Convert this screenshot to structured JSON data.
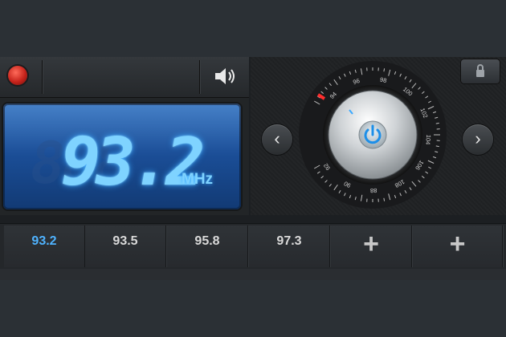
{
  "window": {
    "background": "#2b3035"
  },
  "topbar": {
    "record_icon": "record-icon",
    "speaker_icon": "speaker-icon"
  },
  "display": {
    "frequency": "93.2",
    "ghost_digits": "888",
    "unit": "MHz",
    "accent_color": "#7fd3ff"
  },
  "tuner": {
    "lock_icon": "lock-icon",
    "prev_icon": "chevron-left-icon",
    "next_icon": "chevron-right-icon",
    "power_icon": "power-icon",
    "scale_labels": [
      "94",
      "96",
      "98",
      "100",
      "102",
      "104",
      "106",
      "108",
      "88",
      "90",
      "92"
    ],
    "needle_color": "#ff2d2d"
  },
  "presets": [
    {
      "label": "93.2",
      "active": true
    },
    {
      "label": "93.5",
      "active": false
    },
    {
      "label": "95.8",
      "active": false
    },
    {
      "label": "97.3",
      "active": false
    },
    {
      "label": "+",
      "active": false
    },
    {
      "label": "+",
      "active": false
    }
  ]
}
